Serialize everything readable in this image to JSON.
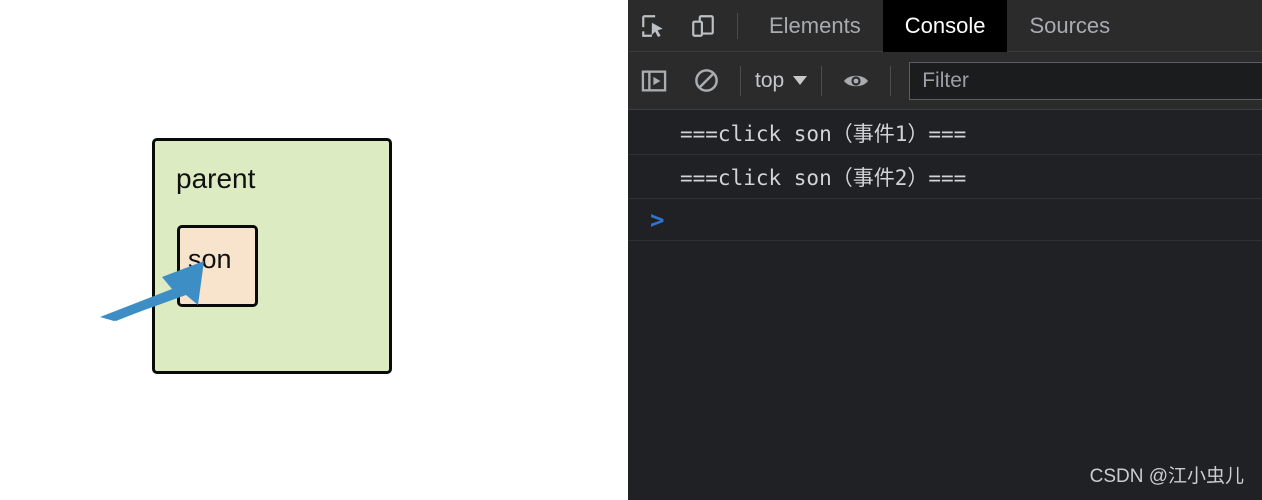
{
  "page": {
    "parent_label": "parent",
    "son_label": "son",
    "parent_bg": "#dcebc2",
    "son_bg": "#f8e4cd",
    "border_color": "#0a0a0a",
    "arrow_color": "#3d8ec5",
    "arrow_name": "pointer-arrow-annotation"
  },
  "devtools": {
    "tabbar": {
      "inspect_icon": "inspect-element-icon",
      "device_icon": "device-toolbar-icon",
      "tabs": [
        {
          "label": "Elements",
          "selected": false
        },
        {
          "label": "Console",
          "selected": true
        },
        {
          "label": "Sources",
          "selected": false
        }
      ]
    },
    "console_toolbar": {
      "sidebar_icon": "console-sidebar-icon",
      "clear_icon": "clear-console-icon",
      "context": "top",
      "eye_icon": "live-expression-eye-icon",
      "filter_placeholder": "Filter",
      "filter_value": ""
    },
    "console_logs": [
      "===click son（事件1）===",
      "===click son（事件2）==="
    ],
    "prompt": ">",
    "watermark": "CSDN @江小虫儿"
  }
}
